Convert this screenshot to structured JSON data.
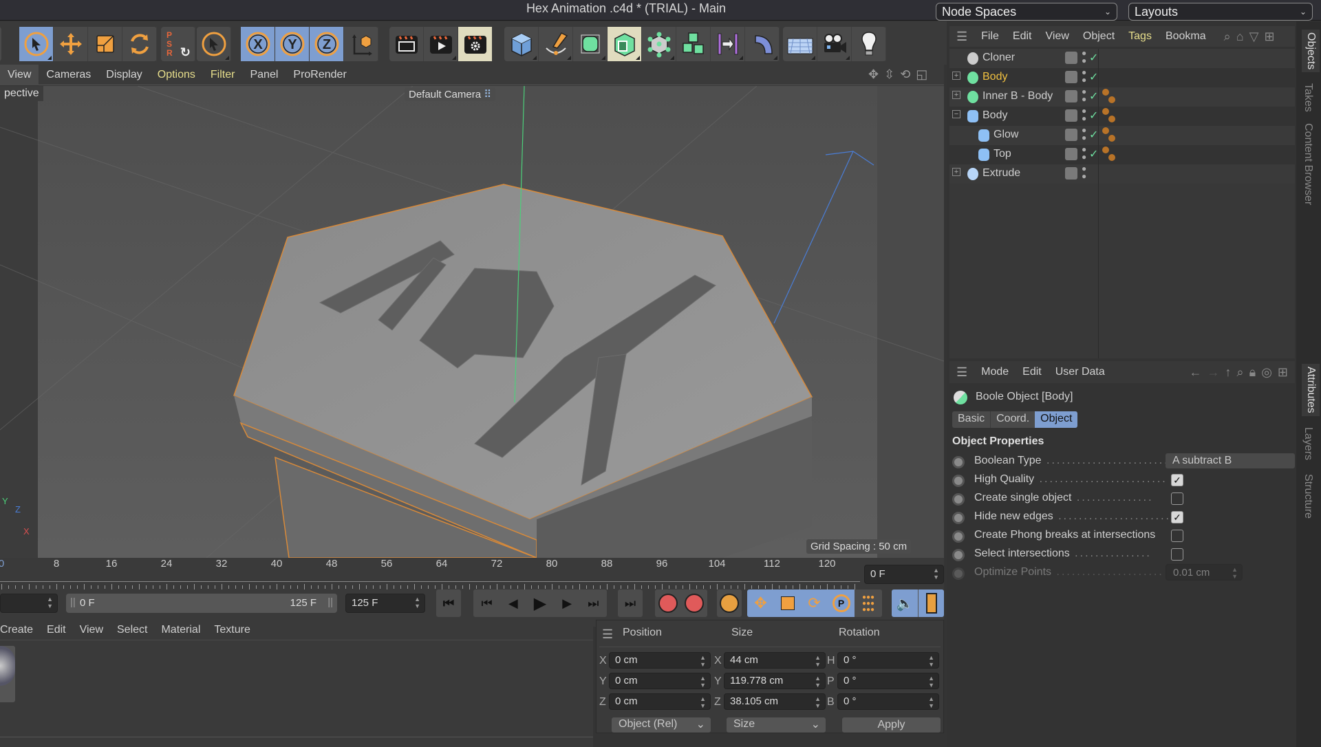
{
  "window": {
    "title": "Hex Animation .c4d * (TRIAL) - Main"
  },
  "top_selects": {
    "node_spaces": "Node Spaces",
    "layouts": "Layouts"
  },
  "viewport_menu": [
    "View",
    "Cameras",
    "Display",
    "Options",
    "Filter",
    "Panel",
    "ProRender"
  ],
  "viewport": {
    "projection_label": "pective",
    "camera_label": "Default Camera",
    "grid_spacing": "Grid Spacing : 50 cm",
    "axis": {
      "x": "X",
      "y": "Y",
      "z": "Z"
    }
  },
  "toolbar": {
    "mode_tools": [
      "select-tool",
      "move-tool",
      "scale-tool",
      "rotate-tool"
    ],
    "psr_label": [
      "P",
      "S",
      "R"
    ],
    "axis_locks": [
      "X",
      "Y",
      "Z"
    ],
    "render_tools": [
      "render-view",
      "render-picture-viewer",
      "render-settings"
    ],
    "create_tools": [
      "cube",
      "pen",
      "subdivision-surface",
      "boole",
      "cloner",
      "mograph-cloner-cubes",
      "symmetry",
      "deformer-bend",
      "floor",
      "camera",
      "light"
    ]
  },
  "timeline": {
    "ticks": [
      "0",
      "8",
      "16",
      "24",
      "32",
      "40",
      "48",
      "56",
      "64",
      "72",
      "80",
      "88",
      "96",
      "104",
      "112",
      "120"
    ],
    "current_frame": "0 F",
    "range_start": "0 F",
    "range_end": "125 F",
    "max_frame": "125 F"
  },
  "material_menu": [
    "Create",
    "Edit",
    "View",
    "Select",
    "Material",
    "Texture"
  ],
  "coords": {
    "headers": {
      "position": "Position",
      "size": "Size",
      "rotation": "Rotation"
    },
    "rows": [
      {
        "pl": "X",
        "pv": "0 cm",
        "sl": "X",
        "sv": "44 cm",
        "rl": "H",
        "rv": "0 °"
      },
      {
        "pl": "Y",
        "pv": "0 cm",
        "sl": "Y",
        "sv": "119.778 cm",
        "rl": "P",
        "rv": "0 °"
      },
      {
        "pl": "Z",
        "pv": "0 cm",
        "sl": "Z",
        "sv": "38.105 cm",
        "rl": "B",
        "rv": "0 °"
      }
    ],
    "mode_select": "Object (Rel)",
    "size_select": "Size",
    "apply_label": "Apply"
  },
  "objects_panel": {
    "menu": [
      "File",
      "Edit",
      "View",
      "Object",
      "Tags",
      "Bookma"
    ],
    "items": [
      {
        "name": "Cloner",
        "icon": "cloner-icon",
        "level": 0,
        "expander": "",
        "selected": false,
        "tags": false
      },
      {
        "name": "Body",
        "icon": "boole-icon",
        "level": 0,
        "expander": "+",
        "selected": true,
        "tags": false
      },
      {
        "name": "Inner B - Body",
        "icon": "extrude-cube-icon",
        "level": 0,
        "expander": "+",
        "selected": false,
        "tags": true
      },
      {
        "name": "Body",
        "icon": "cylinder-icon",
        "level": 0,
        "expander": "−",
        "selected": false,
        "tags": true
      },
      {
        "name": "Glow",
        "icon": "cylinder-icon",
        "level": 1,
        "expander": "",
        "selected": false,
        "tags": true
      },
      {
        "name": "Top",
        "icon": "cylinder-icon",
        "level": 1,
        "expander": "",
        "selected": false,
        "tags": true
      },
      {
        "name": "Extrude",
        "icon": "extrude-icon",
        "level": 0,
        "expander": "+",
        "selected": false,
        "tags": false,
        "no_check": true
      }
    ]
  },
  "side_tabs_top": [
    "Objects",
    "Takes",
    "Content Browser"
  ],
  "side_tabs_bottom": [
    "Attributes",
    "Layers",
    "Structure"
  ],
  "attributes": {
    "menu": [
      "Mode",
      "Edit",
      "User Data"
    ],
    "object_title": "Boole Object [Body]",
    "tabs": [
      "Basic",
      "Coord.",
      "Object"
    ],
    "active_tab": "Object",
    "section": "Object Properties",
    "props": [
      {
        "label": "Boolean Type",
        "type": "select",
        "value": "A subtract B"
      },
      {
        "label": "High Quality",
        "type": "check",
        "value": true
      },
      {
        "label": "Create single object",
        "type": "check",
        "value": false
      },
      {
        "label": "Hide new edges",
        "type": "check",
        "value": true
      },
      {
        "label": "Create Phong breaks at intersections",
        "type": "check",
        "value": false
      },
      {
        "label": "Select intersections",
        "type": "check",
        "value": false
      },
      {
        "label": "Optimize Points",
        "type": "number",
        "value": "0.01 cm",
        "disabled": true
      }
    ]
  },
  "colors": {
    "accent_blue": "#7e9ed0",
    "selected_yellow": "#f0c040",
    "menu_yellow": "#e8df8c",
    "tool_orange": "#f0a040"
  }
}
